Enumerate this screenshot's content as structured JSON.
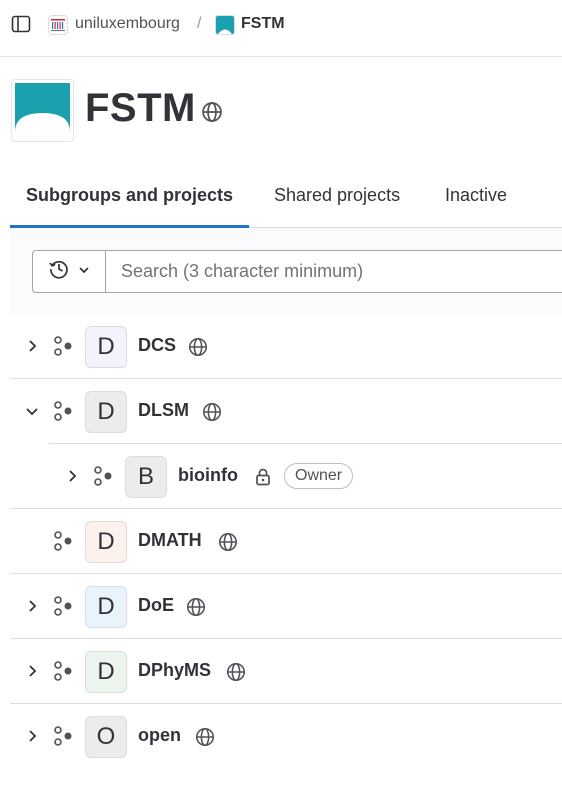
{
  "breadcrumb": {
    "items": [
      {
        "label": "uniluxembourg"
      },
      {
        "label": "FSTM"
      }
    ],
    "separator": "/"
  },
  "group": {
    "title": "FSTM",
    "visibility_icon": "globe-icon",
    "logo_color": "#1aa1ad"
  },
  "tabs": [
    {
      "label": "Subgroups and projects",
      "active": true
    },
    {
      "label": "Shared projects",
      "active": false
    },
    {
      "label": "Inactive",
      "active": false
    }
  ],
  "filter": {
    "history_icon": "history-icon",
    "search_placeholder": "Search (3 character minimum)"
  },
  "list": [
    {
      "initial": "D",
      "name": "DCS",
      "expanded": false,
      "has_children": true,
      "visibility": "globe-icon",
      "avatar_bg": "#f3f2fd"
    },
    {
      "initial": "D",
      "name": "DLSM",
      "expanded": true,
      "has_children": true,
      "visibility": "globe-icon",
      "avatar_bg": "#ececef"
    },
    {
      "initial": "B",
      "name": "bioinfo",
      "expanded": false,
      "has_children": true,
      "visibility": "lock-icon",
      "badge": "Owner",
      "avatar_bg": "#ececef",
      "child": true
    },
    {
      "initial": "D",
      "name": "DMATH",
      "expanded": false,
      "has_children": false,
      "visibility": "globe-icon",
      "avatar_bg": "#fdf1ee"
    },
    {
      "initial": "D",
      "name": "DoE",
      "expanded": false,
      "has_children": true,
      "visibility": "globe-icon",
      "avatar_bg": "#e9f3fc"
    },
    {
      "initial": "D",
      "name": "DPhyMS",
      "expanded": false,
      "has_children": true,
      "visibility": "globe-icon",
      "avatar_bg": "#ecf4ee"
    },
    {
      "initial": "O",
      "name": "open",
      "expanded": false,
      "has_children": true,
      "visibility": "globe-icon",
      "avatar_bg": "#ececef"
    }
  ]
}
